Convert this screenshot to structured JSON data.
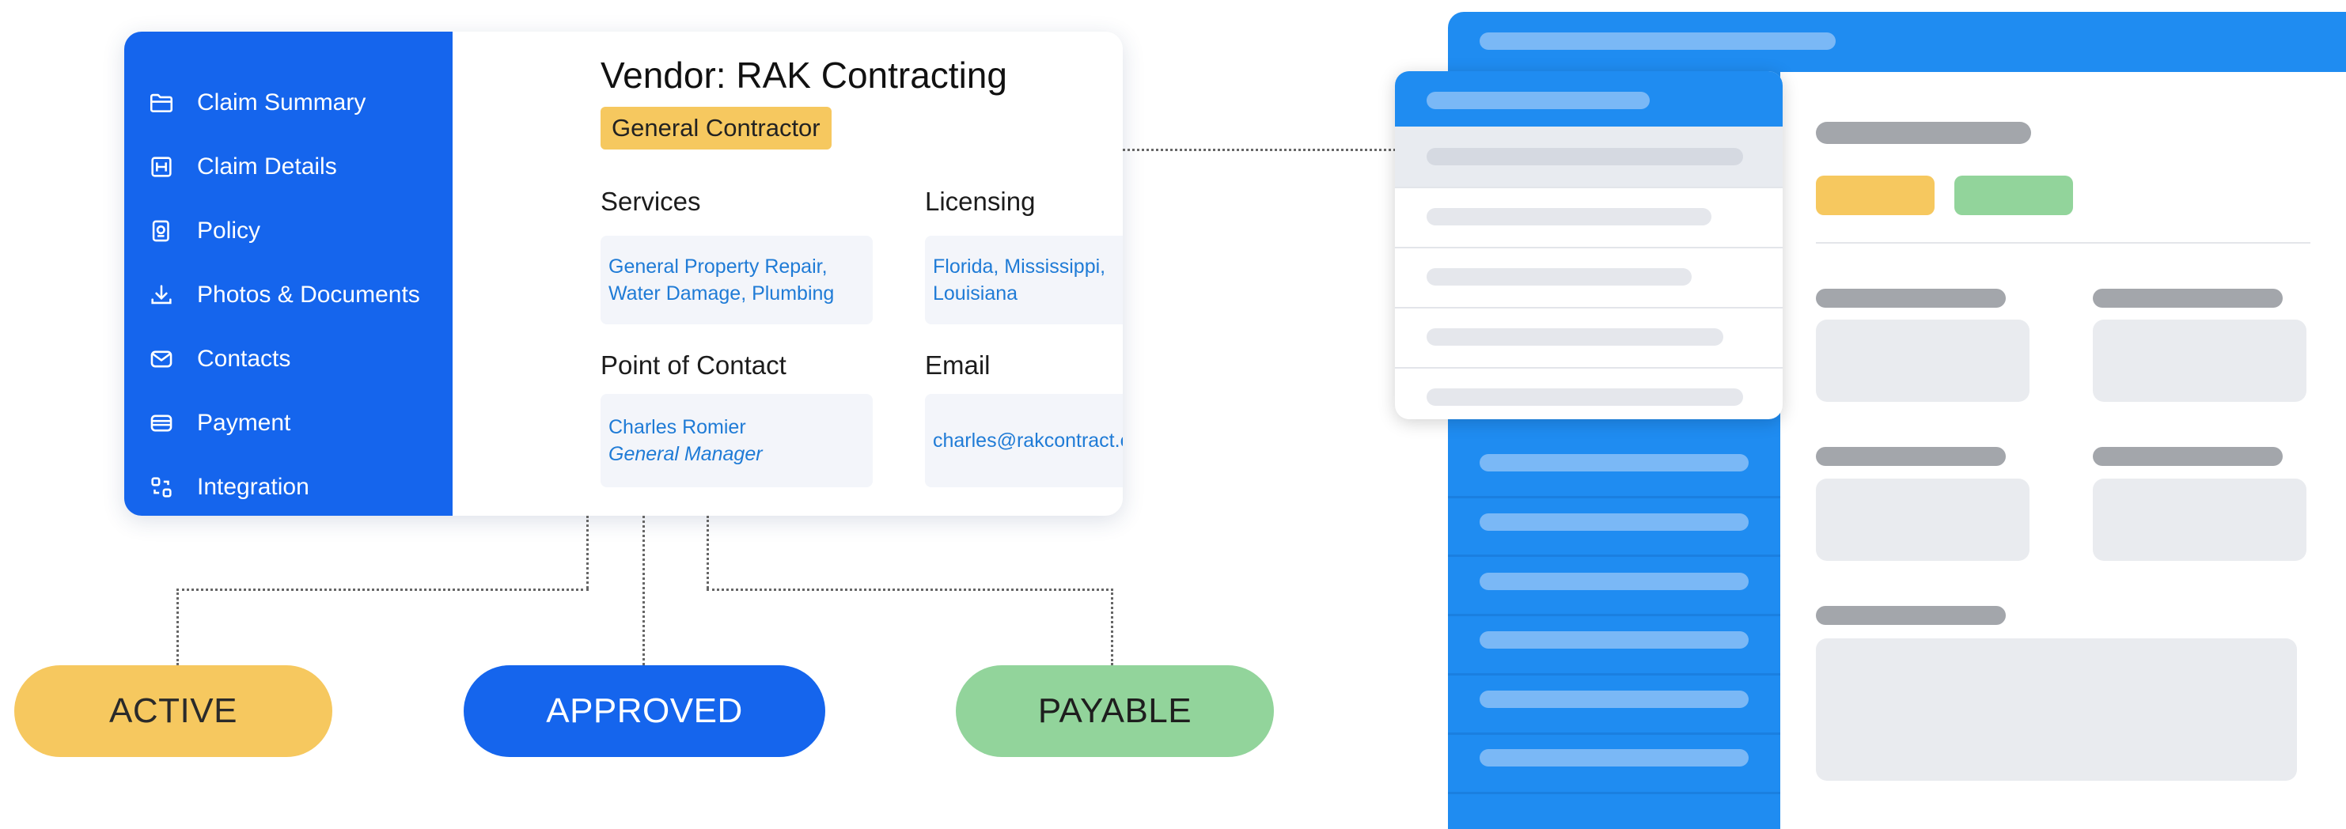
{
  "vendor_card": {
    "sidebar": {
      "items": [
        {
          "label": "Claim Summary",
          "icon": "folder-icon"
        },
        {
          "label": "Claim Details",
          "icon": "details-icon"
        },
        {
          "label": "Policy",
          "icon": "policy-icon"
        },
        {
          "label": "Photos & Documents",
          "icon": "download-icon"
        },
        {
          "label": "Contacts",
          "icon": "mail-icon"
        },
        {
          "label": "Payment",
          "icon": "card-icon"
        },
        {
          "label": "Integration",
          "icon": "integration-icon"
        }
      ]
    },
    "title_prefix": "Vendor:",
    "title_name": "RAK Contracting",
    "type_badge": "General Contractor",
    "services": {
      "label": "Services",
      "lines": [
        "General Property Repair,",
        "Water Damage, Plumbing"
      ]
    },
    "licensing": {
      "label": "Licensing",
      "lines": [
        "Florida, Mississippi,",
        "Louisiana"
      ]
    },
    "point_of_contact": {
      "label": "Point of Contact",
      "name": "Charles Romier",
      "role": "General Manager"
    },
    "email": {
      "label": "Email",
      "value": "charles@rakcontract.com"
    }
  },
  "statuses": [
    {
      "label": "ACTIVE",
      "color": "#f6c85f"
    },
    {
      "label": "APPROVED",
      "color": "#1565ed"
    },
    {
      "label": "PAYABLE",
      "color": "#92d49b"
    }
  ],
  "colors": {
    "brand_blue": "#1565ed",
    "wireframe_blue": "#1f8cf1",
    "link_text": "#1f7bd6",
    "badge_yellow": "#f6c85f",
    "badge_green": "#92d49b"
  }
}
